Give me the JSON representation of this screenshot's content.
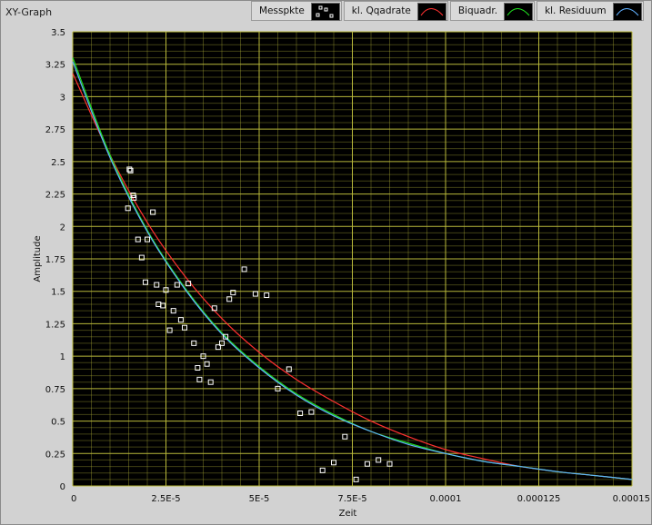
{
  "window": {
    "title": "XY-Graph"
  },
  "legend": [
    {
      "label": "Messpkte",
      "kind": "points",
      "color": "#ffffff"
    },
    {
      "label": "kl. Qqadrate",
      "kind": "line",
      "color": "#ff3030"
    },
    {
      "label": "Biquadr.",
      "kind": "line",
      "color": "#20e020"
    },
    {
      "label": "kl. Residuum",
      "kind": "line",
      "color": "#60b0ff"
    }
  ],
  "chart_data": {
    "type": "scatter",
    "xlabel": "Zeit",
    "ylabel": "Amplitude",
    "xlim": [
      0,
      0.00015
    ],
    "ylim": [
      0,
      3.5
    ],
    "x_ticks": [
      {
        "value": 0,
        "label": "0"
      },
      {
        "value": 2.5e-05,
        "label": "2.5E-5"
      },
      {
        "value": 5e-05,
        "label": "5E-5"
      },
      {
        "value": 7.5e-05,
        "label": "7.5E-5"
      },
      {
        "value": 0.0001,
        "label": "0.0001"
      },
      {
        "value": 0.000125,
        "label": "0.000125"
      },
      {
        "value": 0.00015,
        "label": "0.00015"
      }
    ],
    "y_ticks": [
      {
        "value": 0,
        "label": "0"
      },
      {
        "value": 0.25,
        "label": "0.25"
      },
      {
        "value": 0.5,
        "label": "0.5"
      },
      {
        "value": 0.75,
        "label": "0.75"
      },
      {
        "value": 1,
        "label": "1"
      },
      {
        "value": 1.25,
        "label": "1.25"
      },
      {
        "value": 1.5,
        "label": "1.5"
      },
      {
        "value": 1.75,
        "label": "1.75"
      },
      {
        "value": 2,
        "label": "2"
      },
      {
        "value": 2.25,
        "label": "2.25"
      },
      {
        "value": 2.5,
        "label": "2.5"
      },
      {
        "value": 2.75,
        "label": "2.75"
      },
      {
        "value": 3,
        "label": "3"
      },
      {
        "value": 3.25,
        "label": "3.25"
      },
      {
        "value": 3.5,
        "label": "3.5"
      }
    ],
    "grid": true,
    "background": "#000000",
    "grid_color": "#b8b83a",
    "series": [
      {
        "name": "Messpkte",
        "type": "scatter",
        "color": "#ffffff",
        "points": [
          [
            1.52e-05,
            2.44
          ],
          [
            1.55e-05,
            2.43
          ],
          [
            1.62e-05,
            2.24
          ],
          [
            1.64e-05,
            2.22
          ],
          [
            1.48e-05,
            2.14
          ],
          [
            2.15e-05,
            2.11
          ],
          [
            1.75e-05,
            1.9
          ],
          [
            2e-05,
            1.9
          ],
          [
            1.85e-05,
            1.76
          ],
          [
            1.95e-05,
            1.57
          ],
          [
            2.25e-05,
            1.55
          ],
          [
            2.5e-05,
            1.51
          ],
          [
            2.8e-05,
            1.55
          ],
          [
            3.1e-05,
            1.56
          ],
          [
            2.3e-05,
            1.4
          ],
          [
            2.42e-05,
            1.39
          ],
          [
            2.7e-05,
            1.35
          ],
          [
            2.9e-05,
            1.28
          ],
          [
            3e-05,
            1.22
          ],
          [
            2.6e-05,
            1.2
          ],
          [
            3.25e-05,
            1.1
          ],
          [
            3.5e-05,
            1.0
          ],
          [
            3.35e-05,
            0.91
          ],
          [
            3.6e-05,
            0.94
          ],
          [
            3.4e-05,
            0.82
          ],
          [
            3.7e-05,
            0.8
          ],
          [
            3.8e-05,
            1.37
          ],
          [
            4.2e-05,
            1.44
          ],
          [
            4.3e-05,
            1.49
          ],
          [
            4.6e-05,
            1.67
          ],
          [
            4.9e-05,
            1.48
          ],
          [
            5.2e-05,
            1.47
          ],
          [
            4.1e-05,
            1.15
          ],
          [
            4e-05,
            1.1
          ],
          [
            3.9e-05,
            1.07
          ],
          [
            5.8e-05,
            0.9
          ],
          [
            5.5e-05,
            0.75
          ],
          [
            6.1e-05,
            0.56
          ],
          [
            6.4e-05,
            0.57
          ],
          [
            7.3e-05,
            0.38
          ],
          [
            6.7e-05,
            0.12
          ],
          [
            7e-05,
            0.18
          ],
          [
            7.6e-05,
            0.05
          ],
          [
            7.9e-05,
            0.17
          ],
          [
            8.2e-05,
            0.2
          ],
          [
            8.5e-05,
            0.17
          ]
        ]
      },
      {
        "name": "kl. Qqadrate",
        "type": "line",
        "color": "#ff3030",
        "points": [
          [
            0,
            3.18
          ],
          [
            1e-05,
            2.55
          ],
          [
            2e-05,
            2.03
          ],
          [
            3e-05,
            1.62
          ],
          [
            4e-05,
            1.29
          ],
          [
            5e-05,
            1.03
          ],
          [
            6e-05,
            0.82
          ],
          [
            7e-05,
            0.65
          ],
          [
            8e-05,
            0.5
          ],
          [
            9e-05,
            0.38
          ],
          [
            0.0001,
            0.28
          ],
          [
            0.00011,
            0.21
          ],
          [
            0.00012,
            0.15
          ],
          [
            0.00013,
            0.11
          ],
          [
            0.00014,
            0.08
          ],
          [
            0.00015,
            0.05
          ]
        ]
      },
      {
        "name": "Biquadr.",
        "type": "line",
        "color": "#20e020",
        "points": [
          [
            0,
            3.3
          ],
          [
            1e-05,
            2.55
          ],
          [
            2e-05,
            1.97
          ],
          [
            3e-05,
            1.53
          ],
          [
            4e-05,
            1.18
          ],
          [
            5e-05,
            0.92
          ],
          [
            6e-05,
            0.71
          ],
          [
            7e-05,
            0.55
          ],
          [
            8e-05,
            0.42
          ],
          [
            9e-05,
            0.33
          ],
          [
            0.0001,
            0.25
          ],
          [
            0.00011,
            0.19
          ],
          [
            0.00012,
            0.15
          ],
          [
            0.00013,
            0.11
          ],
          [
            0.00014,
            0.08
          ],
          [
            0.00015,
            0.05
          ]
        ]
      },
      {
        "name": "kl. Residuum",
        "type": "line",
        "color": "#60b0ff",
        "points": [
          [
            0,
            3.27
          ],
          [
            1e-05,
            2.53
          ],
          [
            2e-05,
            1.96
          ],
          [
            3e-05,
            1.52
          ],
          [
            4e-05,
            1.17
          ],
          [
            5e-05,
            0.91
          ],
          [
            6e-05,
            0.7
          ],
          [
            7e-05,
            0.54
          ],
          [
            8e-05,
            0.42
          ],
          [
            9e-05,
            0.32
          ],
          [
            0.0001,
            0.25
          ],
          [
            0.00011,
            0.19
          ],
          [
            0.00012,
            0.15
          ],
          [
            0.00013,
            0.11
          ],
          [
            0.00014,
            0.08
          ],
          [
            0.00015,
            0.05
          ]
        ]
      }
    ]
  }
}
